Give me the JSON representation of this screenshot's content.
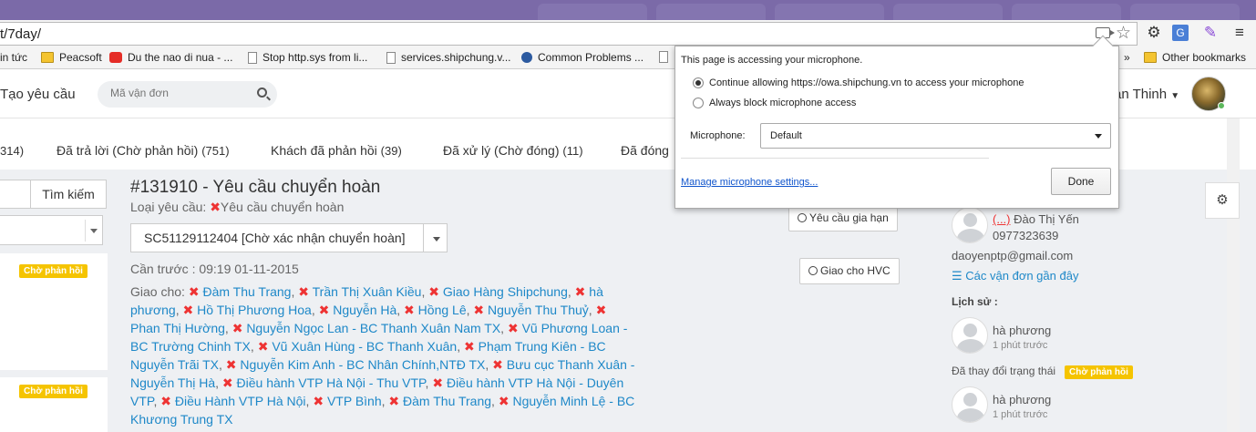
{
  "browser": {
    "url": "t/7day/",
    "bookmarks": [
      {
        "label": "in tức",
        "icon": "none"
      },
      {
        "label": "Peacsoft",
        "icon": "folder-icon"
      },
      {
        "label": "Du the nao di nua - ...",
        "icon": "youtube-icon"
      },
      {
        "label": "Stop http.sys from li...",
        "icon": "page-icon"
      },
      {
        "label": "services.shipchung.v...",
        "icon": "page-icon"
      },
      {
        "label": "Common Problems ...",
        "icon": "globe-icon"
      }
    ],
    "bookmarks_overflow": "»",
    "other_bookmarks": "Other bookmarks"
  },
  "header": {
    "new_request": "Tạo yêu cầu",
    "search_placeholder": "Mã vận đơn",
    "username": "an Thinh"
  },
  "tabs": [
    {
      "label": "",
      "count": "314)"
    },
    {
      "label": "Đã trả lời (Chờ phản hồi)",
      "count": "(751)"
    },
    {
      "label": "Khách đã phản hồi",
      "count": "(39)"
    },
    {
      "label": "Đã xử lý (Chờ đóng)",
      "count": "(11)"
    },
    {
      "label": "Đã đóng",
      "count": ""
    }
  ],
  "left": {
    "search_button": "Tìm kiếm",
    "badge1": "Chờ phản hồi",
    "badge2": "Chờ phản hồi"
  },
  "ticket": {
    "title": "#131910 - Yêu cầu chuyển hoàn",
    "type_prefix": "Loại yêu cầu:",
    "type_value": "Yêu cầu chuyển hoàn",
    "waybill": "SC51129112404 [Chờ xác nhận chuyển hoàn]",
    "extend_button": "Yêu cầu gia hạn",
    "deliver_button": "Giao cho HVC",
    "deadline": "Cần trước : 09:19 01-11-2015",
    "assign_label": "Giao cho:",
    "assignees": [
      "Đàm Thu Trang",
      "Trần Thị Xuân Kiều",
      "Giao Hàng Shipchung",
      "hà phương",
      "Hồ Thị Phương Hoa",
      "Nguyễn Hà",
      "Hồng Lê",
      "Nguyễn Thu Thuỷ",
      "Phan Thị Hường",
      "Nguyễn Ngọc Lan - BC Thanh Xuân Nam TX",
      "Vũ Phương Loan - BC Trường Chinh TX",
      "Vũ Xuân Hùng - BC Thanh Xuân",
      "Phạm Trung Kiên - BC Nguyễn Trãi TX",
      "Nguyễn Kim Anh - BC Nhân Chính,NTĐ TX",
      "Bưu cục Thanh Xuân - Nguyễn Thị Hà",
      "Điều hành VTP Hà Nội - Thu VTP",
      "Điều hành VTP Hà Nội - Duyên VTP",
      "Điều Hành VTP Hà Nội",
      "VTP Bình",
      "Đàm Thu Trang",
      "Nguyễn Minh Lệ - BC Khương Trung TX"
    ]
  },
  "right": {
    "customer_prefix": "(...)",
    "customer_name": "Đào Thị Yến",
    "customer_phone": "0977323639",
    "customer_email": "daoyenptp@gmail.com",
    "recent_waybills": "Các vận đơn gần đây",
    "history_label": "Lịch sử :",
    "history": [
      {
        "user": "hà phương",
        "time": "1 phút trước"
      },
      {
        "user": "hà phương",
        "time": "1 phút trước"
      }
    ],
    "status_change_text": "Đã thay đổi trạng thái",
    "status_change_badge": "Chờ phản hồi"
  },
  "mic_bubble": {
    "title": "This page is accessing your microphone.",
    "option_allow": "Continue allowing https://owa.shipchung.vn to access your microphone",
    "option_block": "Always block microphone access",
    "selected": "allow",
    "mic_label": "Microphone:",
    "mic_value": "Default",
    "manage_link": "Manage microphone settings...",
    "done_button": "Done"
  }
}
